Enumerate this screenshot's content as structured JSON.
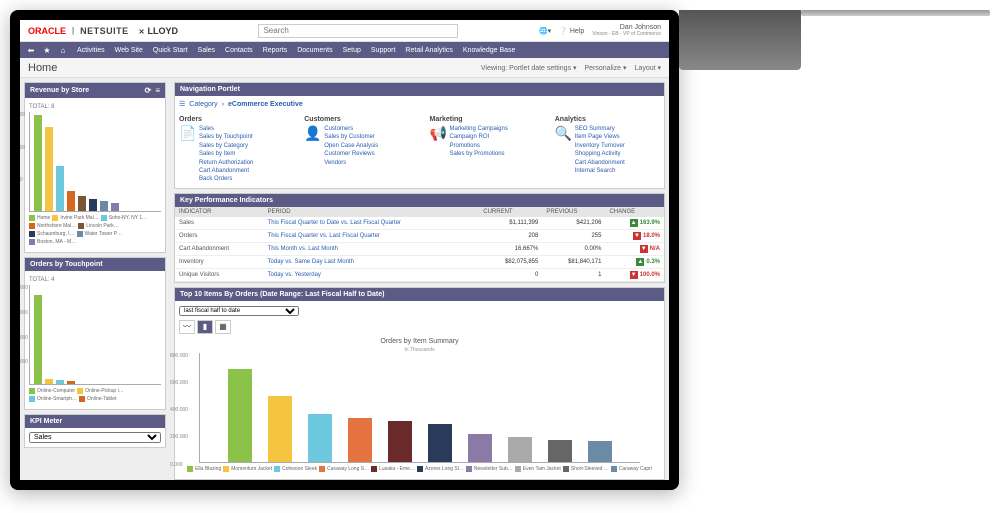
{
  "brand": {
    "oracle": "ORACLE",
    "netsuite": "NETSUITE",
    "partner": "LLOYD"
  },
  "search": {
    "placeholder": "Search"
  },
  "user": {
    "help": "Help",
    "name": "Dan Johnson",
    "role": "Vinson - EB - VP of Commerce"
  },
  "menu": [
    "Activities",
    "Web Site",
    "Quick Start",
    "Sales",
    "Contacts",
    "Reports",
    "Documents",
    "Setup",
    "Support",
    "Retail Analytics",
    "Knowledge Base"
  ],
  "page": {
    "title": "Home",
    "viewing": "Viewing: Portlet date settings ▾",
    "personalize": "Personalize ▾",
    "layout": "Layout ▾"
  },
  "revenue": {
    "title": "Revenue by Store",
    "total": "TOTAL: 8",
    "legend": [
      "Home",
      "Irvine Park Mal…",
      "Soho-NY, NY 1…",
      "Northshore Mal…",
      "Lincoln Park…",
      "Schaumburg, I…",
      "Water Tower P…",
      "Boston, MA - M…"
    ]
  },
  "touchpoint": {
    "title": "Orders by Touchpoint",
    "total": "TOTAL: 4",
    "legend": [
      "Online-Computer",
      "Online-Pickup i…",
      "Online-Smartph…",
      "Online-Tablet"
    ]
  },
  "kpimeter": {
    "title": "KPI Meter",
    "option": "Sales"
  },
  "navport": {
    "title": "Navigation Portlet",
    "breadcrumb": [
      "Category",
      "eCommerce Executive"
    ],
    "cols": [
      {
        "h": "Orders",
        "links": [
          "Sales",
          "Sales by Touchpoint",
          "Sales by Category",
          "Sales by Item",
          "Return Authorization",
          "Cart Abandonment",
          "Back Orders"
        ]
      },
      {
        "h": "Customers",
        "links": [
          "Customers",
          "Sales by Customer",
          "Open Case Analysis",
          "Customer Reviews",
          "Vendors"
        ]
      },
      {
        "h": "Marketing",
        "links": [
          "Marketing Campaigns",
          "Campaign ROI",
          "Promotions",
          "Sales by Promotions"
        ]
      },
      {
        "h": "Analytics",
        "links": [
          "SEO Summary",
          "Item Page Views",
          "Inventory Turnover",
          "Shopping Activity",
          "Cart Abandonment",
          "Internal Search"
        ]
      }
    ]
  },
  "kpi": {
    "title": "Key Performance Indicators",
    "headers": [
      "INDICATOR",
      "PERIOD",
      "CURRENT",
      "PREVIOUS",
      "CHANGE"
    ],
    "rows": [
      {
        "ind": "Sales",
        "per": "This Fiscal Quarter to Date vs. Last Fiscal Quarter",
        "cur": "$1,111,399",
        "prev": "$421,206",
        "chg": "163.9%",
        "dir": "up"
      },
      {
        "ind": "Orders",
        "per": "This Fiscal Quarter vs. Last Fiscal Quarter",
        "cur": "208",
        "prev": "255",
        "chg": "18.0%",
        "dir": "down"
      },
      {
        "ind": "Cart Abandonment",
        "per": "This Month vs. Last Month",
        "cur": "16.667%",
        "prev": "0.00%",
        "chg": "N/A",
        "dir": "down"
      },
      {
        "ind": "Inventory",
        "per": "Today vs. Same Day Last Month",
        "cur": "$82,075,855",
        "prev": "$81,840,171",
        "chg": "0.3%",
        "dir": "up"
      },
      {
        "ind": "Unique Visitors",
        "per": "Today vs. Yesterday",
        "cur": "0",
        "prev": "1",
        "chg": "100.0%",
        "dir": "down"
      }
    ]
  },
  "topitems": {
    "title": "Top 10 Items By Orders (Date Range: Last Fiscal Half to Date)",
    "select": "last fiscal half to date",
    "chart_title": "Orders by Item Summary",
    "chart_sub": "In Thousands",
    "legend": [
      "Ella Blazing",
      "Momentum Jacket",
      "Cohesion Sleek",
      "Caraway Long S…",
      "Lusaka - Eme…",
      "Azores Long Sl…",
      "Newsletter Sub…",
      "Even Tam Jacket",
      "Short-Sleeved …",
      "Caraway Capri"
    ]
  },
  "chart_data": [
    {
      "type": "bar",
      "title": "Revenue by Store",
      "ylabel": "",
      "ylim": [
        0,
        15000
      ],
      "categories": [
        "Home",
        "Irvine Park",
        "Soho-NY",
        "Northshore",
        "Lincoln Park",
        "Schaumburg",
        "Water Tower",
        "Boston"
      ],
      "values": [
        14500,
        12800,
        6800,
        3000,
        2200,
        1800,
        1500,
        1200
      ],
      "colors": [
        "#8bc34a",
        "#f5c542",
        "#6dc7dd",
        "#d2691e",
        "#7b5536",
        "#2a3a5a",
        "#6a8aa5",
        "#8a7aa8"
      ]
    },
    {
      "type": "bar",
      "title": "Orders by Touchpoint",
      "ylabel": "",
      "ylim": [
        0,
        800000
      ],
      "categories": [
        "Online-Computer",
        "Online-Pickup",
        "Online-Smartphone",
        "Online-Tablet"
      ],
      "values": [
        720000,
        40000,
        30000,
        25000
      ],
      "colors": [
        "#8bc34a",
        "#f5c542",
        "#6dc7dd",
        "#d2691e"
      ]
    },
    {
      "type": "bar",
      "title": "Orders by Item Summary",
      "ylabel": "In Thousands",
      "ylim": [
        0,
        800
      ],
      "categories": [
        "Ella Blazing",
        "Momentum Jacket",
        "Cohesion Sleek",
        "Caraway Long S",
        "Lusaka",
        "Azores Long Sl",
        "Newsletter Sub",
        "Even Tam Jacket",
        "Short-Sleeved",
        "Caraway Capri"
      ],
      "values": [
        680,
        480,
        350,
        320,
        300,
        280,
        200,
        180,
        160,
        150
      ],
      "colors": [
        "#8bc34a",
        "#f5c542",
        "#6dc7dd",
        "#e57340",
        "#6b2b2b",
        "#2a3a5a",
        "#8a7aa8",
        "#aaa",
        "#666",
        "#6a8aa5"
      ]
    }
  ]
}
